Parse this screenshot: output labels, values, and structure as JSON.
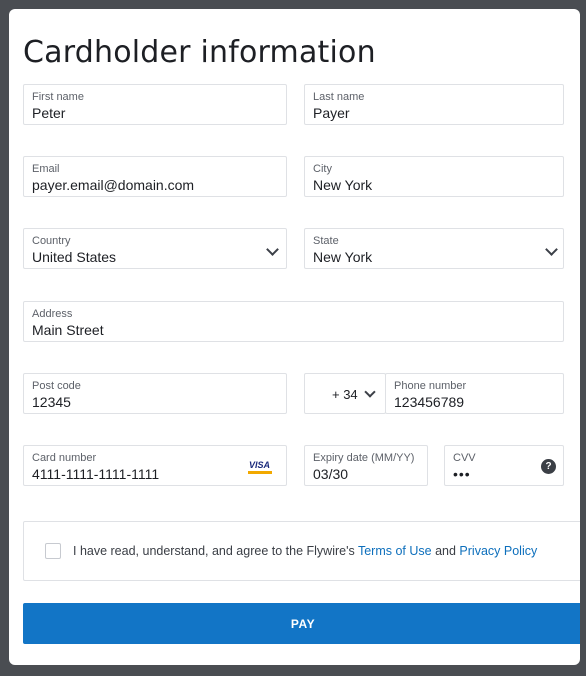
{
  "form": {
    "title": "Cardholder information",
    "first_name": {
      "label": "First name",
      "value": "Peter"
    },
    "last_name": {
      "label": "Last name",
      "value": "Payer"
    },
    "email": {
      "label": "Email",
      "value": "payer.email@domain.com"
    },
    "city": {
      "label": "City",
      "value": "New York"
    },
    "country": {
      "label": "Country",
      "value": "United States"
    },
    "state": {
      "label": "State",
      "value": "New York"
    },
    "address": {
      "label": "Address",
      "value": "Main Street"
    },
    "post_code": {
      "label": "Post code",
      "value": "12345"
    },
    "phone_prefix": {
      "value": "+ 34"
    },
    "phone_number": {
      "label": "Phone number",
      "value": "123456789"
    },
    "card_number": {
      "label": "Card number",
      "value": "4111-1111-1111-1111",
      "card_brand_text": "VISA"
    },
    "expiry": {
      "label": "Expiry date (MM/YY)",
      "value": "03/30"
    },
    "cvv": {
      "label": "CVV",
      "value": "•••",
      "help_glyph": "?"
    },
    "agreement": {
      "prefix": "I have read, understand, and agree to the Flywire's ",
      "terms_link": "Terms of Use",
      "and": " and ",
      "privacy_link": "Privacy Policy"
    },
    "pay_label": "PAY"
  },
  "colors": {
    "accent": "#1275c6",
    "link": "#0d6fbc",
    "page_bg": "#4a4d52"
  },
  "icons": [
    "chevron-down-icon",
    "visa-card-icon",
    "help-icon",
    "checkbox"
  ]
}
